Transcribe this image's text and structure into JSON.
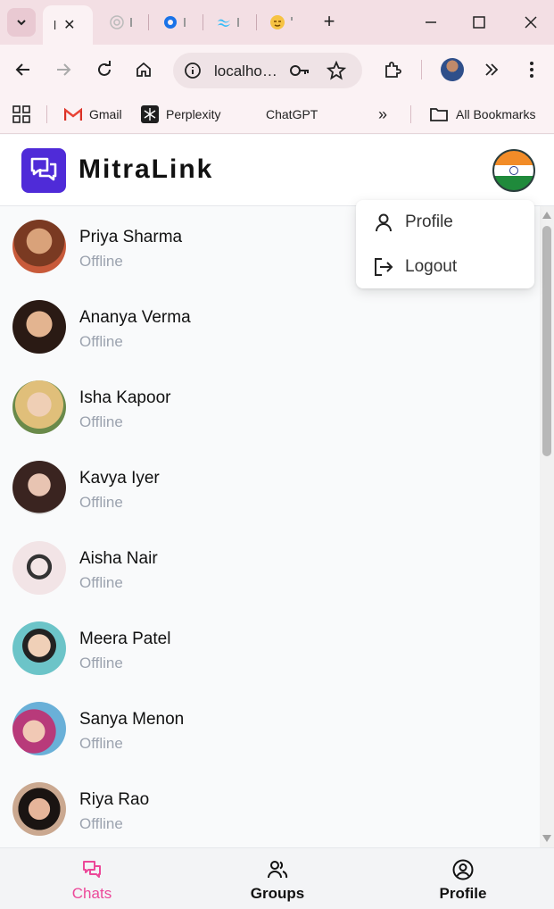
{
  "browser": {
    "tabs": [
      {
        "title": "l",
        "active": true
      },
      {
        "icon": "openai-icon"
      },
      {
        "icon": "gear-icon"
      },
      {
        "icon": "tailwind-icon"
      },
      {
        "icon": "emoji-icon"
      }
    ],
    "address": "localho…",
    "bookmarks": [
      {
        "label": "Gmail",
        "icon": "gmail-icon"
      },
      {
        "label": "Perplexity",
        "icon": "perplexity-icon"
      },
      {
        "label": "ChatGPT",
        "icon": "chatgpt-icon"
      },
      {
        "label": "All Bookmarks",
        "icon": "folder-icon"
      }
    ],
    "more_bookmarks": "»"
  },
  "app": {
    "brand": "MitraLink",
    "colors": {
      "brand": "#4f2bd8",
      "active_nav": "#ec4899"
    }
  },
  "menu": {
    "items": [
      {
        "label": "Profile",
        "icon": "user-icon"
      },
      {
        "label": "Logout",
        "icon": "logout-icon"
      }
    ]
  },
  "chats": [
    {
      "name": "Priya Sharma",
      "status": "Offline"
    },
    {
      "name": "Ananya Verma",
      "status": "Offline"
    },
    {
      "name": "Isha Kapoor",
      "status": "Offline"
    },
    {
      "name": "Kavya Iyer",
      "status": "Offline"
    },
    {
      "name": "Aisha Nair",
      "status": "Offline"
    },
    {
      "name": "Meera Patel",
      "status": "Offline"
    },
    {
      "name": "Sanya Menon",
      "status": "Offline"
    },
    {
      "name": "Riya Rao",
      "status": "Offline"
    }
  ],
  "bottom_nav": [
    {
      "label": "Chats",
      "icon": "chat-icon",
      "active": true
    },
    {
      "label": "Groups",
      "icon": "groups-icon",
      "active": false
    },
    {
      "label": "Profile",
      "icon": "profile-circle-icon",
      "active": false
    }
  ]
}
